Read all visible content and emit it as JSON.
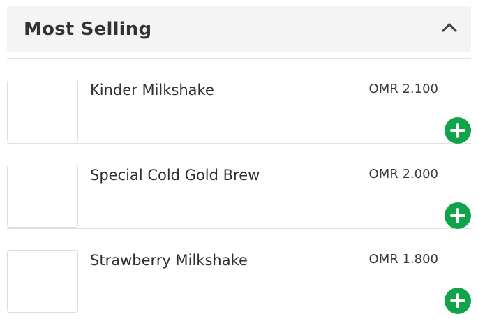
{
  "section": {
    "title": "Most Selling",
    "toggle_icon": "chevron-up-icon"
  },
  "colors": {
    "header_background": "#f4f4f4",
    "add_button": "#0fa34a",
    "divider": "#e2e2e2"
  },
  "items": [
    {
      "name": "Kinder Milkshake",
      "price": "OMR 2.100",
      "add_icon": "plus-icon"
    },
    {
      "name": "Special Cold Gold Brew",
      "price": "OMR 2.000",
      "add_icon": "plus-icon"
    },
    {
      "name": "Strawberry Milkshake",
      "price": "OMR 1.800",
      "add_icon": "plus-icon"
    }
  ]
}
